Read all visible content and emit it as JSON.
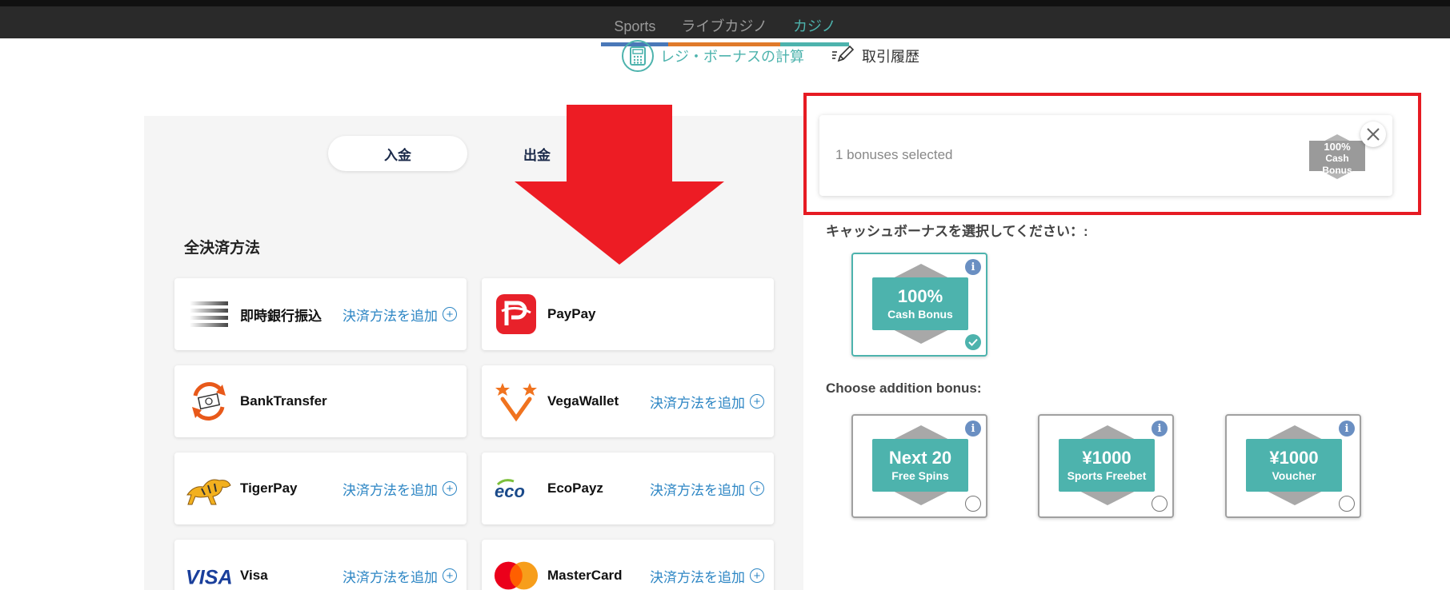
{
  "nav": {
    "tabs": [
      {
        "label": "Sports",
        "bar_color": "#4a78b8",
        "active": false
      },
      {
        "label": "ライブカジノ",
        "bar_color": "#e07a2a",
        "active": false
      },
      {
        "label": "カジノ",
        "bar_color": "#4db3ad",
        "active": true
      }
    ]
  },
  "subnav": {
    "calc_label": "レジ・ボーナスの計算",
    "history_label": "取引履歴"
  },
  "cashier": {
    "deposit_tab": "入金",
    "withdraw_tab": "出金",
    "section_title": "全決済方法",
    "add_label": "決済方法を追加",
    "methods": [
      {
        "name": "即時銀行振込",
        "icon": "bank-lines-icon",
        "has_add": true
      },
      {
        "name": "PayPay",
        "icon": "paypay-icon",
        "has_add": false
      },
      {
        "name": "BankTransfer",
        "icon": "bank-transfer-icon",
        "has_add": false
      },
      {
        "name": "VegaWallet",
        "icon": "vegawallet-icon",
        "has_add": true
      },
      {
        "name": "TigerPay",
        "icon": "tigerpay-icon",
        "has_add": true
      },
      {
        "name": "EcoPayz",
        "icon": "ecopayz-icon",
        "has_add": true
      },
      {
        "name": "Visa",
        "icon": "visa-icon",
        "has_add": true
      },
      {
        "name": "MasterCard",
        "icon": "mastercard-icon",
        "has_add": true
      }
    ]
  },
  "bonus": {
    "selected_text": "1 bonuses selected",
    "mini_badge": {
      "line1": "100%",
      "line2": "Cash",
      "line3": "Bonus"
    },
    "cash_title": "キャッシュボーナスを選択してください：:",
    "addition_title": "Choose addition bonus:",
    "cash_bonuses": [
      {
        "big": "100%",
        "small": "Cash Bonus",
        "selected": true
      }
    ],
    "addition_bonuses": [
      {
        "big": "Next 20",
        "small": "Free Spins",
        "selected": false
      },
      {
        "big": "¥1000",
        "small": "Sports Freebet",
        "selected": false
      },
      {
        "big": "¥1000",
        "small": "Voucher",
        "selected": false
      }
    ]
  },
  "colors": {
    "accent": "#4db3ad",
    "link": "#2d86c4",
    "highlight": "#e61b23"
  }
}
